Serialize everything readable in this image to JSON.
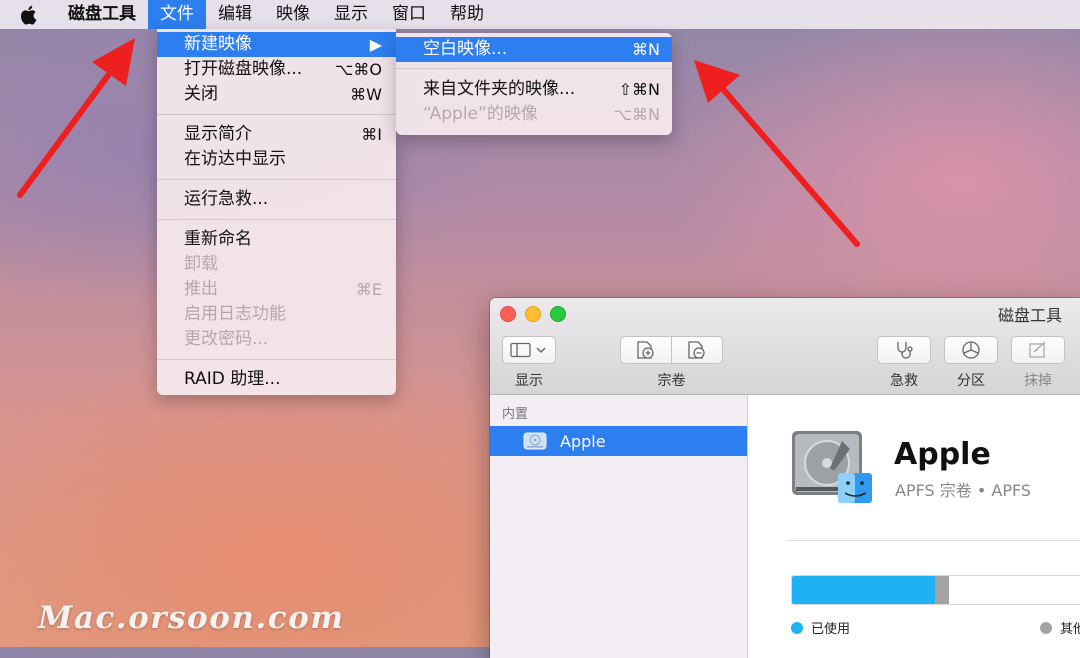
{
  "menubar": {
    "apple_icon": "apple-logo-icon",
    "items": [
      "磁盘工具",
      "文件",
      "编辑",
      "映像",
      "显示",
      "窗口",
      "帮助"
    ],
    "active_index": 1
  },
  "file_menu": {
    "groups": [
      [
        {
          "label": "新建映像",
          "shortcut": "▶",
          "highlighted": true
        },
        {
          "label": "打开磁盘映像...",
          "shortcut": "⌥⌘O"
        },
        {
          "label": "关闭",
          "shortcut": "⌘W"
        }
      ],
      [
        {
          "label": "显示简介",
          "shortcut": "⌘I"
        },
        {
          "label": "在访达中显示",
          "shortcut": ""
        }
      ],
      [
        {
          "label": "运行急救...",
          "shortcut": ""
        }
      ],
      [
        {
          "label": "重新命名",
          "shortcut": ""
        },
        {
          "label": "卸载",
          "shortcut": "",
          "disabled": true
        },
        {
          "label": "推出",
          "shortcut": "⌘E",
          "disabled": true
        },
        {
          "label": "启用日志功能",
          "shortcut": "",
          "disabled": true
        },
        {
          "label": "更改密码...",
          "shortcut": "",
          "disabled": true
        }
      ],
      [
        {
          "label": "RAID 助理...",
          "shortcut": ""
        }
      ]
    ]
  },
  "new_image_submenu": {
    "items": [
      {
        "label": "空白映像...",
        "shortcut": "⌘N",
        "highlighted": true
      },
      {
        "label": "来自文件夹的映像...",
        "shortcut": "⇧⌘N"
      },
      {
        "label": "“Apple”的映像",
        "shortcut": "⌥⌘N",
        "disabled": true
      }
    ]
  },
  "window": {
    "title": "磁盘工具",
    "toolbar": {
      "view_label": "显示",
      "volume_label": "宗卷",
      "first_aid_label": "急救",
      "partition_label": "分区",
      "erase_label": "抹掉"
    },
    "sidebar": {
      "section": "内置",
      "items": [
        {
          "label": "Apple",
          "selected": true
        }
      ]
    },
    "volume": {
      "name": "Apple",
      "subtitle": "APFS 宗卷 • APFS"
    },
    "usage": {
      "used_fraction": 0.36,
      "other_fraction": 0.035,
      "legend_used": "已使用",
      "legend_other": "其他",
      "colors": {
        "used": "#1eb1f3",
        "other": "#a3a3a3"
      }
    }
  },
  "watermark": "Mac.orsoon.com",
  "colors": {
    "accent": "#2d7ef0",
    "arrow": "#ee1f1f"
  }
}
